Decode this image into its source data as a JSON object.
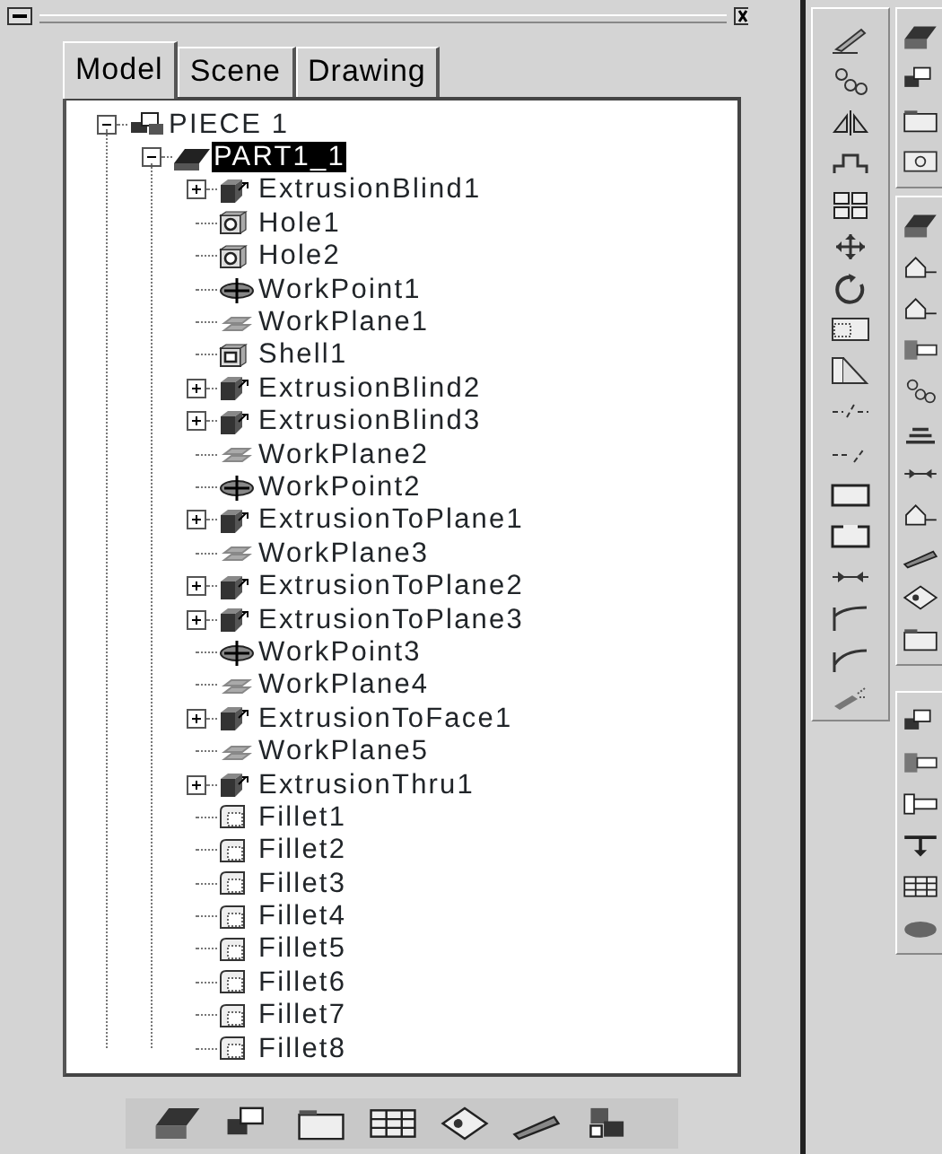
{
  "tabs": [
    {
      "label": "Model",
      "selected": true
    },
    {
      "label": "Scene",
      "selected": false
    },
    {
      "label": "Drawing",
      "selected": false
    }
  ],
  "tree": [
    {
      "label": "PIECE 1",
      "kind": "assembly",
      "expanded": true,
      "selected": false,
      "children": [
        {
          "label": "PART1_1",
          "kind": "part",
          "expanded": true,
          "selected": true,
          "children": [
            {
              "label": "ExtrusionBlind1",
              "kind": "extrusion",
              "expanded": false,
              "selected": false
            },
            {
              "label": "Hole1",
              "kind": "hole",
              "selected": false
            },
            {
              "label": "Hole2",
              "kind": "hole",
              "selected": false
            },
            {
              "label": "WorkPoint1",
              "kind": "workpoint",
              "selected": false
            },
            {
              "label": "WorkPlane1",
              "kind": "workplane",
              "selected": false
            },
            {
              "label": "Shell1",
              "kind": "shell",
              "selected": false
            },
            {
              "label": "ExtrusionBlind2",
              "kind": "extrusion",
              "expanded": false,
              "selected": false
            },
            {
              "label": "ExtrusionBlind3",
              "kind": "extrusion",
              "expanded": false,
              "selected": false
            },
            {
              "label": "WorkPlane2",
              "kind": "workplane",
              "selected": false
            },
            {
              "label": "WorkPoint2",
              "kind": "workpoint",
              "selected": false
            },
            {
              "label": "ExtrusionToPlane1",
              "kind": "extrusion",
              "expanded": false,
              "selected": false
            },
            {
              "label": "WorkPlane3",
              "kind": "workplane",
              "selected": false
            },
            {
              "label": "ExtrusionToPlane2",
              "kind": "extrusion",
              "expanded": false,
              "selected": false
            },
            {
              "label": "ExtrusionToPlane3",
              "kind": "extrusion",
              "expanded": false,
              "selected": false
            },
            {
              "label": "WorkPoint3",
              "kind": "workpoint",
              "selected": false
            },
            {
              "label": "WorkPlane4",
              "kind": "workplane",
              "selected": false
            },
            {
              "label": "ExtrusionToFace1",
              "kind": "extrusion",
              "expanded": false,
              "selected": false
            },
            {
              "label": "WorkPlane5",
              "kind": "workplane",
              "selected": false
            },
            {
              "label": "ExtrusionThru1",
              "kind": "extrusion",
              "expanded": false,
              "selected": false
            },
            {
              "label": "Fillet1",
              "kind": "fillet",
              "selected": false
            },
            {
              "label": "Fillet2",
              "kind": "fillet",
              "selected": false
            },
            {
              "label": "Fillet3",
              "kind": "fillet",
              "selected": false
            },
            {
              "label": "Fillet4",
              "kind": "fillet",
              "selected": false
            },
            {
              "label": "Fillet5",
              "kind": "fillet",
              "selected": false
            },
            {
              "label": "Fillet6",
              "kind": "fillet",
              "selected": false
            },
            {
              "label": "Fillet7",
              "kind": "fillet",
              "selected": false
            },
            {
              "label": "Fillet8",
              "kind": "fillet",
              "selected": false
            }
          ]
        }
      ]
    }
  ]
}
